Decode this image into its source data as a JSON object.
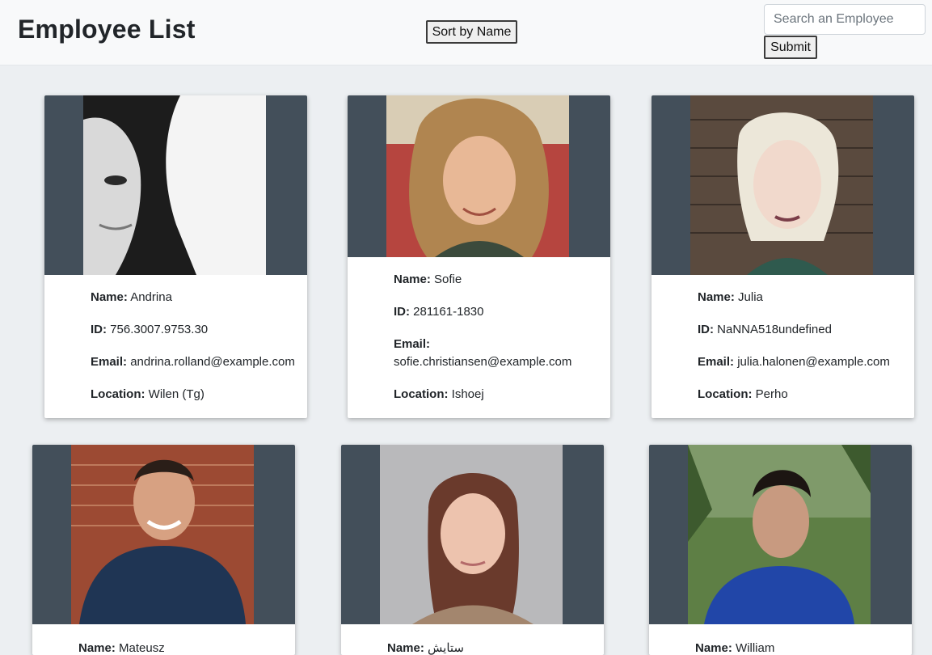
{
  "header": {
    "title": "Employee List",
    "sort_label": "Sort by Name",
    "search_placeholder": "Search an Employee",
    "search_value": "",
    "submit_label": "Submit"
  },
  "field_labels": {
    "name": "Name:",
    "id": "ID:",
    "email": "Email:",
    "location": "Location:"
  },
  "employees": [
    {
      "name": "Andrina",
      "id": "756.3007.9753.30",
      "email": "andrina.rolland@example.com",
      "location": "Wilen (Tg)"
    },
    {
      "name": "Sofie",
      "id": "281161-1830",
      "email": "sofie.christiansen@example.com",
      "location": "Ishoej"
    },
    {
      "name": "Julia",
      "id": "NaNNA518undefined",
      "email": "julia.halonen@example.com",
      "location": "Perho"
    },
    {
      "name": "Mateusz",
      "id": "",
      "email": "",
      "location": ""
    },
    {
      "name": "ستایش",
      "id": "",
      "email": "",
      "location": ""
    },
    {
      "name": "William",
      "id": "",
      "email": "",
      "location": ""
    }
  ],
  "colors": {
    "header_bg": "#f8f9fa",
    "page_bg": "#eceff2",
    "photo_frame": "#434f5a",
    "card_bg": "#ffffff"
  }
}
